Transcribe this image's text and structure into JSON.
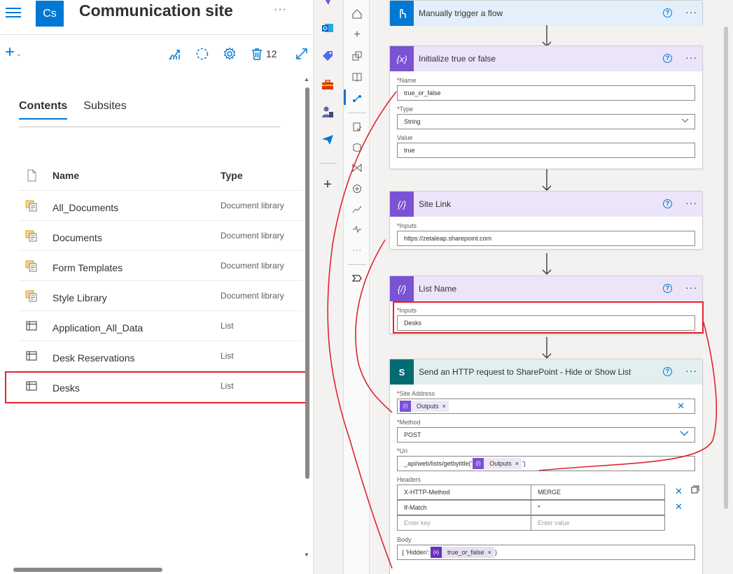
{
  "site": {
    "logo_text": "Cs",
    "title": "Communication site",
    "more": "···"
  },
  "commandbar": {
    "new_plus": "+",
    "new_chevron": "⌄",
    "recycle_count": "12"
  },
  "tabs": [
    {
      "label": "Contents",
      "active": true
    },
    {
      "label": "Subsites",
      "active": false
    }
  ],
  "list": {
    "header": {
      "name": "Name",
      "type": "Type"
    },
    "rows": [
      {
        "name": "All_Documents",
        "type": "Document library",
        "icon": "library-icon"
      },
      {
        "name": "Documents",
        "type": "Document library",
        "icon": "library-icon"
      },
      {
        "name": "Form Templates",
        "type": "Document library",
        "icon": "library-icon"
      },
      {
        "name": "Style Library",
        "type": "Document library",
        "icon": "library-icon"
      },
      {
        "name": "Application_All_Data",
        "type": "List",
        "icon": "list-icon"
      },
      {
        "name": "Desk Reservations",
        "type": "List",
        "icon": "list-icon"
      },
      {
        "name": "Desks",
        "type": "List",
        "icon": "list-icon"
      }
    ]
  },
  "flow": {
    "trigger": {
      "title": "Manually trigger a flow"
    },
    "init": {
      "title": "Initialize true or false",
      "icon_text": "{x}",
      "name_label": "Name",
      "name_value": "true_or_false",
      "type_label": "Type",
      "type_value": "String",
      "value_label": "Value",
      "value_value": "true"
    },
    "site_link": {
      "title": "Site Link",
      "icon_text": "{/}",
      "inputs_label": "Inputs",
      "inputs_value": "https://zetaleap.sharepoint.com"
    },
    "list_name": {
      "title": "List Name",
      "icon_text": "{/}",
      "inputs_label": "Inputs",
      "inputs_value": "Desks"
    },
    "http": {
      "title": "Send an HTTP request to SharePoint - Hide or Show List",
      "icon_text": "S",
      "site_address_label": "Site Address",
      "site_address_token": "Outputs",
      "method_label": "Method",
      "method_value": "POST",
      "uri_label": "Uri",
      "uri_prefix": "_api/web/lists/getbytitle('",
      "uri_token": "Outputs",
      "uri_suffix": "')",
      "headers_label": "Headers",
      "headers": [
        {
          "key": "X-HTTP-Method",
          "value": "MERGE"
        },
        {
          "key": "If-Match",
          "value": "*"
        }
      ],
      "header_key_placeholder": "Enter key",
      "header_value_placeholder": "Enter value",
      "body_label": "Body",
      "body_prefix": "{ 'Hidden':",
      "body_token": "true_or_false",
      "body_suffix": "}"
    },
    "help_glyph": "?",
    "more_glyph": "···",
    "required_mark": "*",
    "clear_glyph": "✕",
    "token_close": "×"
  },
  "colors": {
    "accent": "#0078d4",
    "highlight": "#e0242c",
    "trigger_header": "#e3effb",
    "variable_header": "#ece4f8",
    "variable_icon": "#7a52d4",
    "sharepoint_header": "#e1eff0",
    "sharepoint_icon": "#036c70"
  }
}
